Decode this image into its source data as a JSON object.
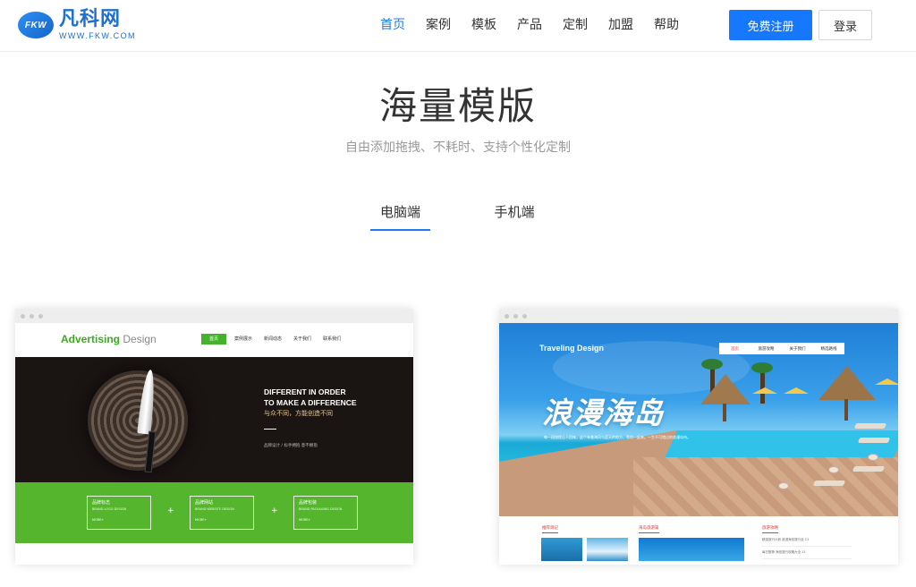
{
  "header": {
    "logo": {
      "badge": "FKW",
      "name": "凡科网",
      "url": "WWW.FKW.COM"
    },
    "nav": [
      {
        "label": "首页",
        "active": true
      },
      {
        "label": "案例",
        "active": false
      },
      {
        "label": "模板",
        "active": false
      },
      {
        "label": "产品",
        "active": false
      },
      {
        "label": "定制",
        "active": false
      },
      {
        "label": "加盟",
        "active": false
      },
      {
        "label": "帮助",
        "active": false
      }
    ],
    "register_label": "免费注册",
    "login_label": "登录"
  },
  "hero": {
    "title": "海量模版",
    "subtitle": "自由添加拖拽、不耗时、支持个性化定制"
  },
  "tabs": [
    {
      "label": "电脑端",
      "active": true
    },
    {
      "label": "手机端",
      "active": false
    }
  ],
  "templates": [
    {
      "brand_primary": "Advertising",
      "brand_secondary": "Design",
      "nav": [
        "首页",
        "案例展示",
        "新闻动态",
        "关于我们",
        "联系我们"
      ],
      "banner_line1": "DIFFERENT IN ORDER",
      "banner_line2": "TO MAKE A DIFFERENCE",
      "banner_line3": "与众不同，方能创造不同",
      "banner_small": "品牌设计 / 标手拥抱 意不拥抱",
      "boxes": [
        {
          "title": "品牌标志",
          "sub": "BRAND LOGO DESIGN",
          "more": "MORE+"
        },
        {
          "title": "品牌网站",
          "sub": "BRAND WEBSITE DESIGN",
          "more": "MORE+"
        },
        {
          "title": "品牌包装",
          "sub": "BRAND PACKAGING DESIGN",
          "more": "MORE+"
        }
      ],
      "plus": "+"
    },
    {
      "brand": "Traveling  Design",
      "nav": [
        "首页",
        "旅游攻略",
        "关于我们",
        "精选路线"
      ],
      "big_text": "浪漫海岛",
      "small_text": "每一段旅程让人回味，这个有着海风与蓝天的地方，等你一起来。一生不可错过的浪漫岛屿。",
      "sections": [
        "推荐目记",
        "海岛旅游篇",
        "旅游攻略"
      ],
      "news": [
        "精选旅行计划 浪漫海岛旅行全 13",
        "每日推荐 海岛旅行攻略大全 11"
      ]
    }
  ],
  "colors": {
    "primary": "#1677ff",
    "nav_active": "#1e7bf0",
    "green": "#55b52c"
  }
}
